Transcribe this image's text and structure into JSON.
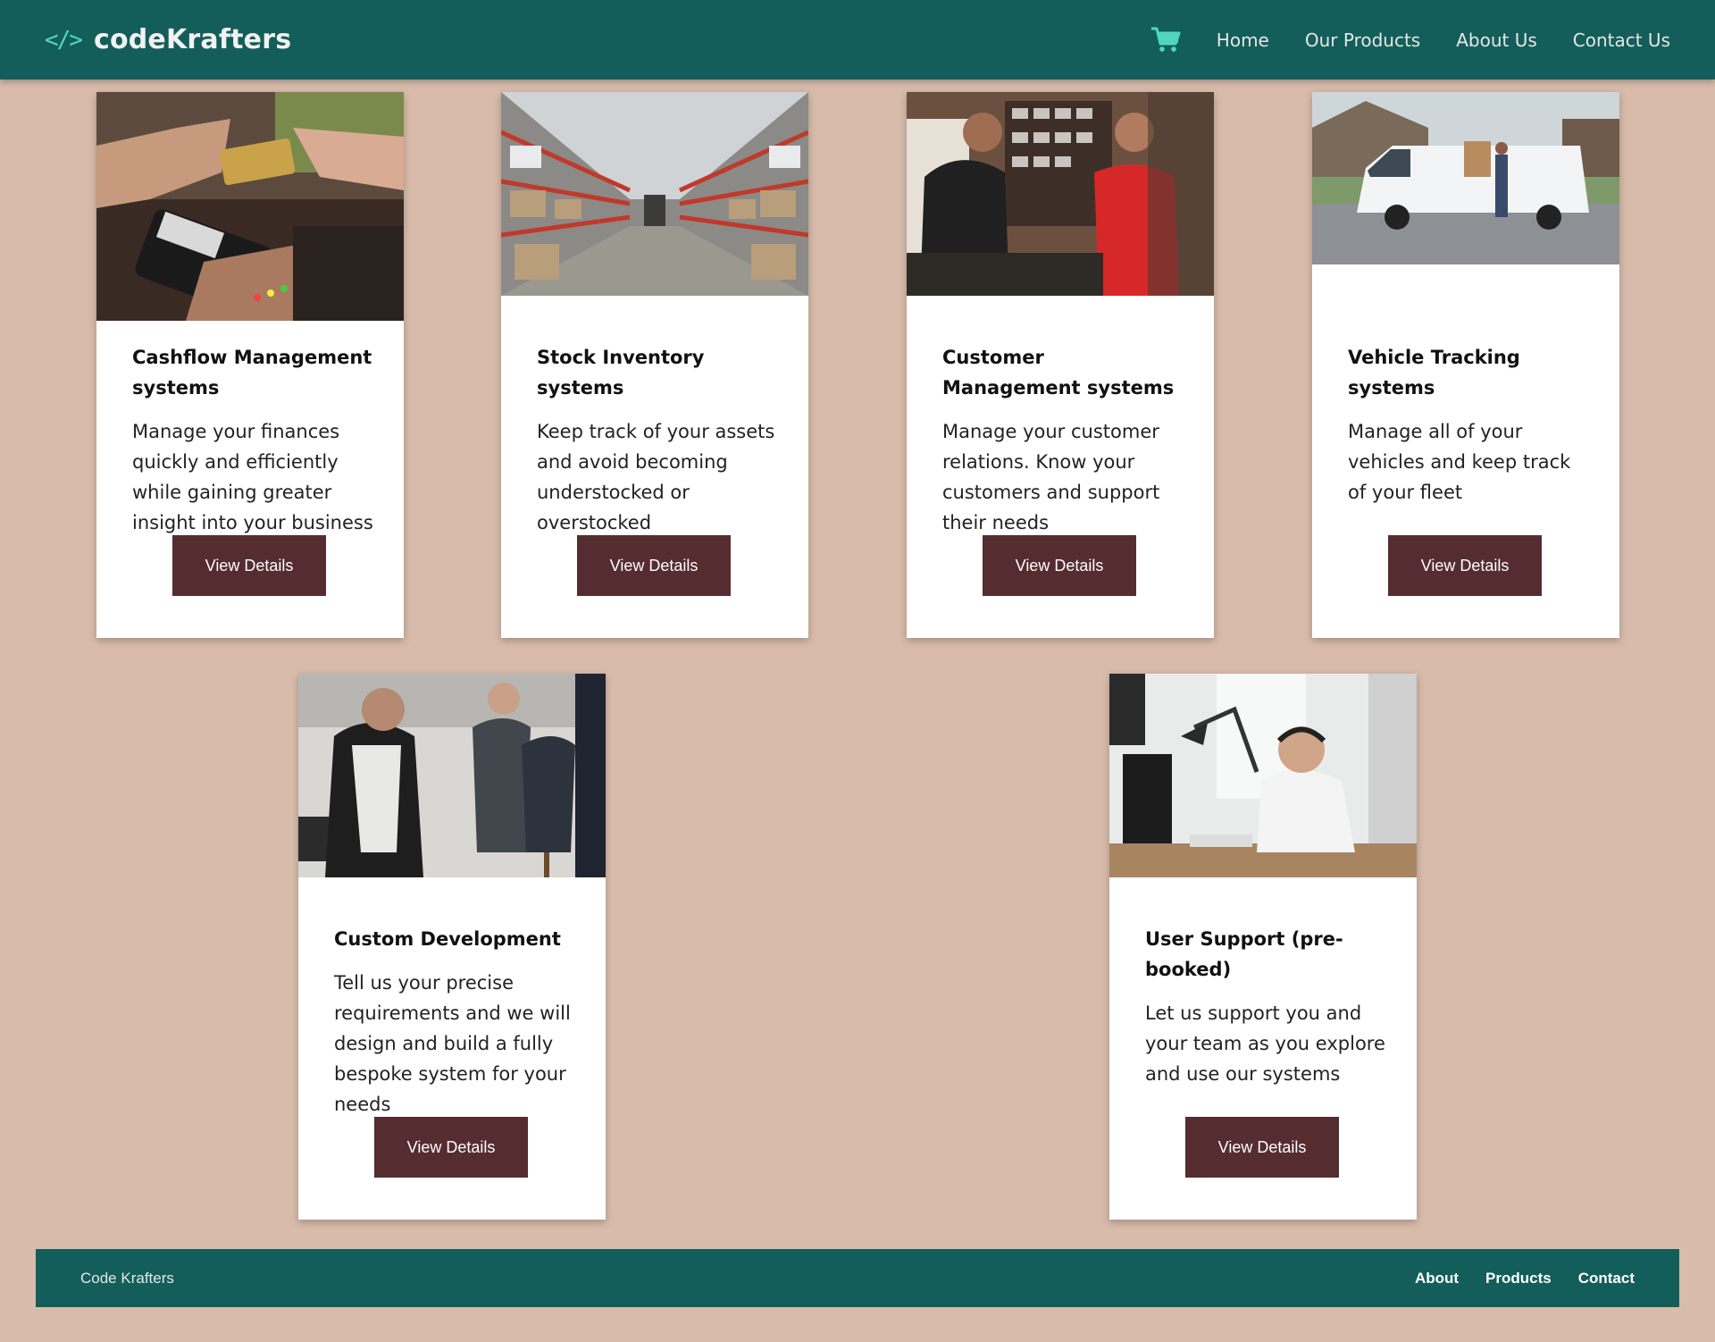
{
  "header": {
    "brand_icon": "</>",
    "brand": "codeKrafters",
    "cart_icon": "shopping-cart-icon",
    "nav": [
      "Home",
      "Our Products",
      "About Us",
      "Contact Us"
    ]
  },
  "cards": [
    {
      "title": "Cashflow Management systems",
      "description": "Manage your finances quickly and efficiently while gaining greater insight into your business",
      "button": "View Details",
      "image": "card-payment-terminal-photo"
    },
    {
      "title": "Stock Inventory systems",
      "description": "Keep track of your assets and avoid becoming understocked or overstocked",
      "button": "View Details",
      "image": "warehouse-shelves-photo"
    },
    {
      "title": "Customer Management systems",
      "description": "Manage your customer relations. Know your customers and support their needs",
      "button": "View Details",
      "image": "shop-customer-conversation-photo"
    },
    {
      "title": "Vehicle Tracking systems",
      "description": "Manage all of your vehicles and keep track of your fleet",
      "button": "View Details",
      "image": "delivery-van-photo"
    },
    {
      "title": "Custom Development",
      "description": "Tell us your precise requirements and we will design and build a fully bespoke system for your needs",
      "button": "View Details",
      "image": "tailor-fitting-photo"
    },
    {
      "title": "User Support (pre-booked)",
      "description": "Let us support you and your team as you explore and use our systems",
      "button": "View Details",
      "image": "support-agent-headset-photo"
    }
  ],
  "footer": {
    "brand": "Code Krafters",
    "links": [
      "About",
      "Products",
      "Contact"
    ]
  },
  "colors": {
    "header_bg": "#135e5a",
    "page_bg": "#d8bbab",
    "button_bg": "#552c2f",
    "accent": "#4fd6c2"
  }
}
